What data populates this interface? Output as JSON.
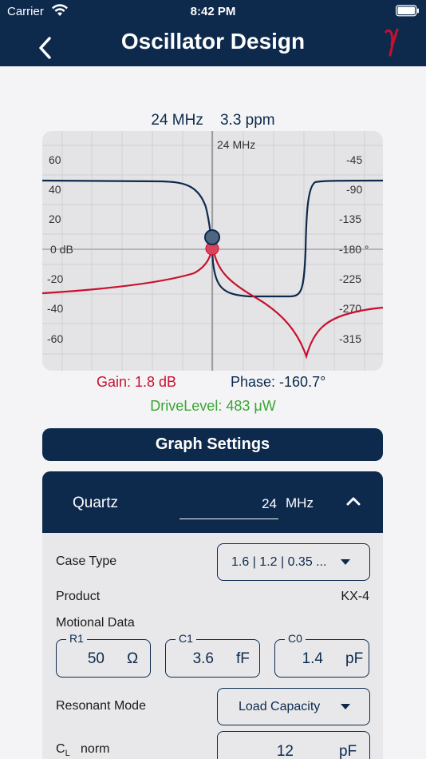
{
  "status": {
    "carrier": "Carrier",
    "time": "8:42 PM"
  },
  "header": {
    "title": "Oscillator Design"
  },
  "summary": {
    "frequency": "24  MHz",
    "ppm": "3.3 ppm"
  },
  "graph": {
    "marker_label": "24 MHz",
    "left_ticks": [
      "60",
      "40",
      "20",
      "0 dB",
      "-20",
      "-40",
      "-60"
    ],
    "right_ticks": [
      "-45",
      "-90",
      "-135",
      "-180  °",
      "-225",
      "-270",
      "-315"
    ]
  },
  "readouts": {
    "gain": "Gain: 1.8 dB",
    "phase": "Phase: -160.7°",
    "drive": "DriveLevel: 483 μW"
  },
  "graph_settings_label": "Graph Settings",
  "quartz": {
    "label": "Quartz",
    "value": "24",
    "unit": "MHz",
    "case_type_label": "Case Type",
    "case_type_value": "1.6 | 1.2 | 0.35 ...",
    "product_label": "Product",
    "product_value": "KX-4",
    "motional_label": "Motional Data",
    "r1": {
      "label": "R1",
      "value": "50",
      "unit": "Ω"
    },
    "c1": {
      "label": "C1",
      "value": "3.6",
      "unit": "fF"
    },
    "c0": {
      "label": "C0",
      "value": "1.4",
      "unit": "pF"
    },
    "resonant_label": "Resonant Mode",
    "resonant_value": "Load Capacity",
    "cl_label": "C",
    "cl_sub": "L",
    "cl_suffix": "norm",
    "cl_value": "12",
    "cl_unit": "pF"
  },
  "colors": {
    "navy": "#0d2a4d",
    "gain": "#c8102e",
    "drive": "#3aa535"
  }
}
